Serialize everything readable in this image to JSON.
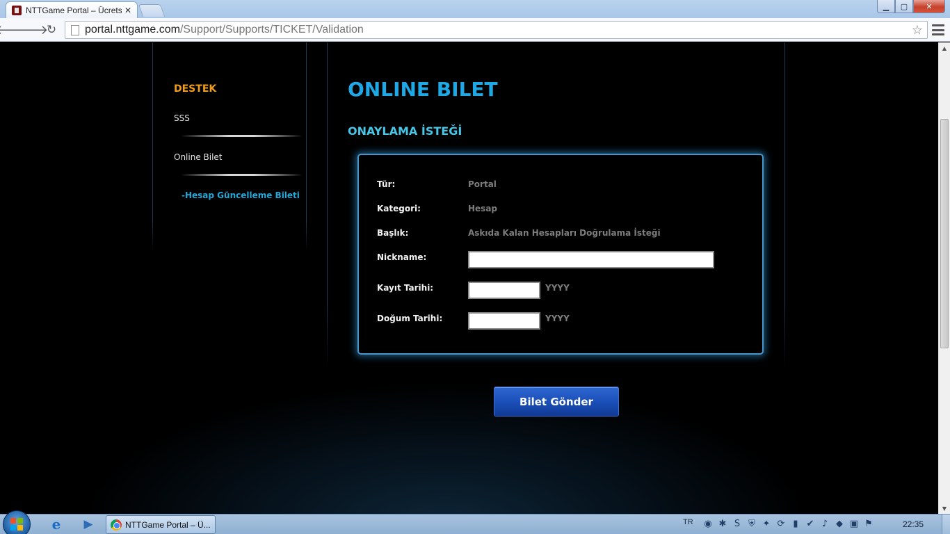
{
  "browser": {
    "tab_title": "NTTGame Portal – Ücretsiz",
    "tab_close": "✕",
    "url_host": "portal.nttgame.com",
    "url_path": "/Support/Supports/TICKET/Validation",
    "window_controls": {
      "minimize": "▁",
      "maximize": "▢",
      "close": "✕"
    },
    "nav": {
      "back": "🡐",
      "forward": "🡒",
      "reload": "↻"
    },
    "star": "☆"
  },
  "sidebar": {
    "title": "DESTEK",
    "items": [
      {
        "label": "SSS"
      },
      {
        "label": "Online Bilet"
      }
    ],
    "subitem": "-Hesap Güncelleme Bileti"
  },
  "main": {
    "title": "ONLINE BILET",
    "section_title": "ONAYLAMA İSTEĞİ",
    "form": {
      "type_label": "Tür:",
      "type_value": "Portal",
      "category_label": "Kategori:",
      "category_value": "Hesap",
      "subject_label": "Başlık:",
      "subject_value": "Askıda Kalan Hesapları Doğrulama İsteği",
      "nickname_label": "Nickname:",
      "nickname_value": "",
      "register_date_label": "Kayıt Tarihi:",
      "register_date_value": "",
      "register_date_hint": "YYYY",
      "birth_date_label": "Doğum Tarihi:",
      "birth_date_value": "",
      "birth_date_hint": "YYYY"
    },
    "submit_label": "Bilet Gönder"
  },
  "taskbar": {
    "task_label": "NTTGame Portal – Ü...",
    "language": "TR",
    "clock": "22:35",
    "tray_icons": [
      "network-icon",
      "bluetooth-icon",
      "skype-icon",
      "shield-icon",
      "messenger-icon",
      "update-icon",
      "signal-icon",
      "checkmark-icon",
      "volume-icon",
      "device-icon",
      "safely-remove-icon",
      "action-center-flag-icon"
    ]
  },
  "colors": {
    "accent_blue": "#1ea9e6",
    "section_cyan": "#47c7e8",
    "sidebar_title_orange": "#f39b1b",
    "sidebar_sub_blue": "#23a8d8",
    "button_blue": "#1b4fb9"
  }
}
